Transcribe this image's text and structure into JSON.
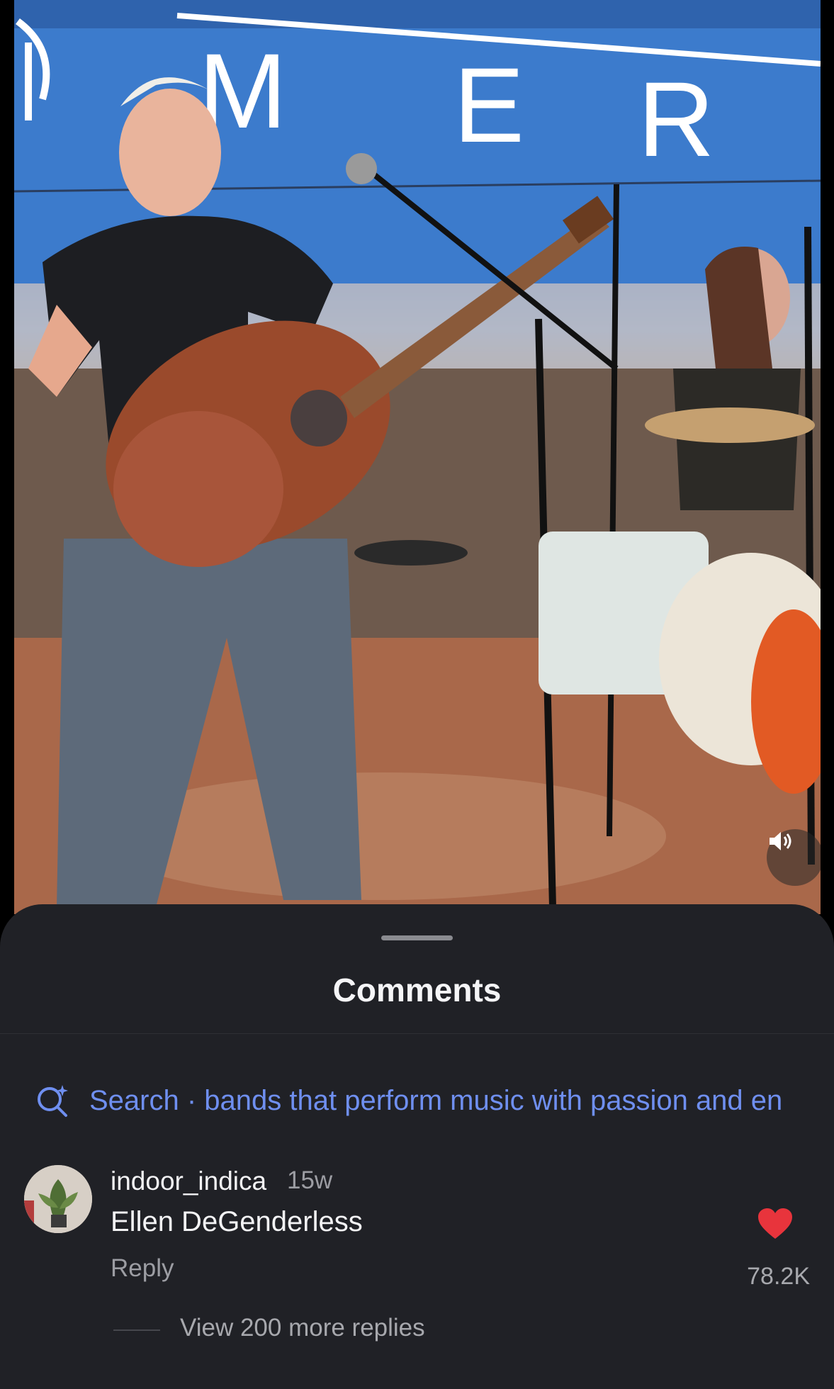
{
  "video": {
    "backdrop_letters": [
      "M",
      "E",
      "R"
    ]
  },
  "comments_sheet": {
    "title": "Comments",
    "search": {
      "label": "Search · bands that perform music with passion and en",
      "icon": "sparkle-search-icon",
      "color": "#6f8ff0"
    },
    "comments": [
      {
        "username": "indoor_indica",
        "timestamp": "15w",
        "text": "Ellen DeGenderless",
        "reply_label": "Reply",
        "likes": "78.2K",
        "liked": true,
        "heart_color": "#e8343c"
      }
    ],
    "view_replies": "View 200 more replies"
  },
  "colors": {
    "sheet_background": "#202126",
    "text_primary": "#f3f3f5",
    "text_secondary": "#9c9da3"
  }
}
